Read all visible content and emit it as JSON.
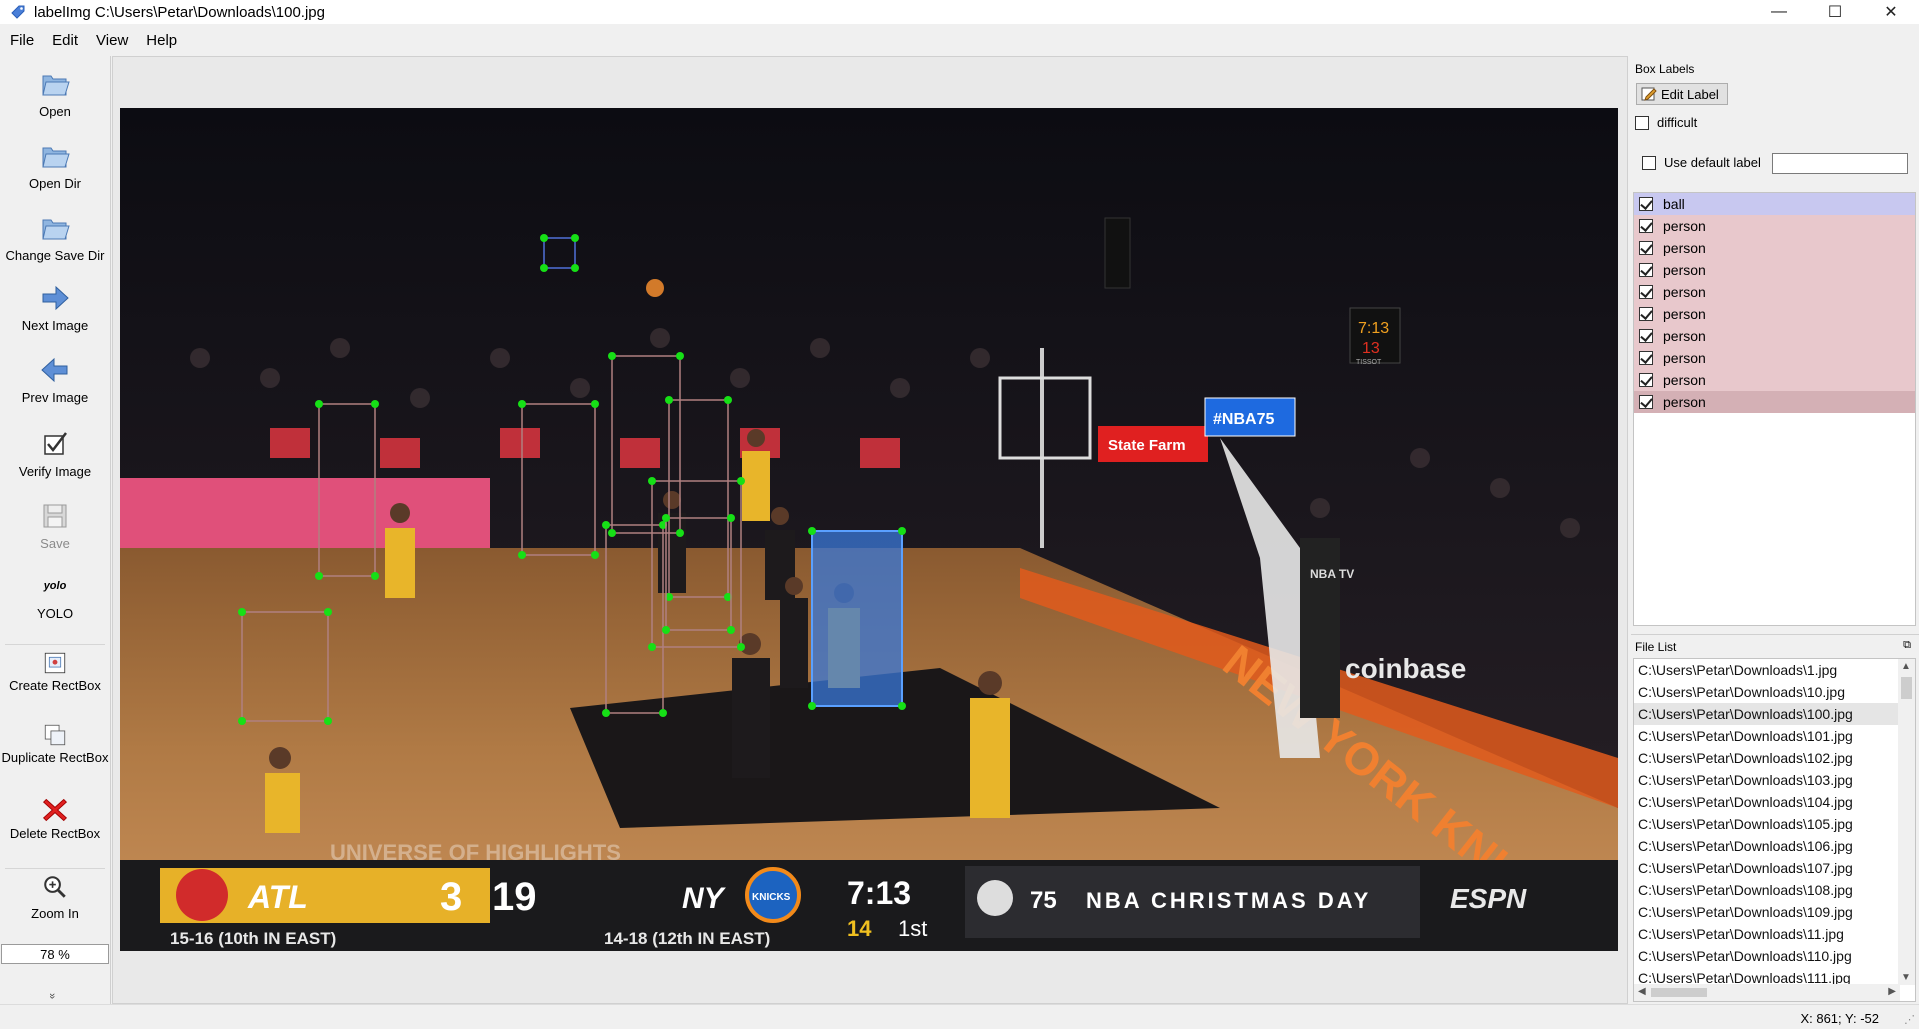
{
  "window": {
    "title": "labelImg C:\\Users\\Petar\\Downloads\\100.jpg",
    "minimize": "—",
    "maximize": "☐",
    "close": "✕"
  },
  "menu": [
    "File",
    "Edit",
    "View",
    "Help"
  ],
  "toolbar": {
    "open": "Open",
    "open_dir": "Open Dir",
    "change_save_dir": "Change Save Dir",
    "next_image": "Next Image",
    "prev_image": "Prev Image",
    "verify_image": "Verify Image",
    "save": "Save",
    "yolo_icon_text": "yolo",
    "yolo": "YOLO",
    "create_rectbox": "Create RectBox",
    "duplicate_rectbox": "Duplicate RectBox",
    "delete_rectbox": "Delete RectBox",
    "zoom_in": "Zoom In",
    "zoom_level": "78 %",
    "more": "»"
  },
  "box_labels": {
    "title": "Box Labels",
    "edit_label": "Edit Label",
    "difficult": "difficult",
    "use_default_label": "Use default label",
    "default_label_value": "",
    "items": [
      {
        "label": "ball",
        "checked": true,
        "color": "#c8c8f0"
      },
      {
        "label": "person",
        "checked": true,
        "color": "#e8c8cc"
      },
      {
        "label": "person",
        "checked": true,
        "color": "#e8c8cc"
      },
      {
        "label": "person",
        "checked": true,
        "color": "#e8c8cc"
      },
      {
        "label": "person",
        "checked": true,
        "color": "#e8c8cc"
      },
      {
        "label": "person",
        "checked": true,
        "color": "#e8c8cc"
      },
      {
        "label": "person",
        "checked": true,
        "color": "#e8c8cc"
      },
      {
        "label": "person",
        "checked": true,
        "color": "#e8c8cc"
      },
      {
        "label": "person",
        "checked": true,
        "color": "#e8c8cc"
      },
      {
        "label": "person",
        "checked": true,
        "color": "#d4b0b5"
      }
    ]
  },
  "file_list": {
    "title": "File List",
    "float_icon": "⧉",
    "selected": "C:\\Users\\Petar\\Downloads\\100.jpg",
    "items": [
      "C:\\Users\\Petar\\Downloads\\1.jpg",
      "C:\\Users\\Petar\\Downloads\\10.jpg",
      "C:\\Users\\Petar\\Downloads\\100.jpg",
      "C:\\Users\\Petar\\Downloads\\101.jpg",
      "C:\\Users\\Petar\\Downloads\\102.jpg",
      "C:\\Users\\Petar\\Downloads\\103.jpg",
      "C:\\Users\\Petar\\Downloads\\104.jpg",
      "C:\\Users\\Petar\\Downloads\\105.jpg",
      "C:\\Users\\Petar\\Downloads\\106.jpg",
      "C:\\Users\\Petar\\Downloads\\107.jpg",
      "C:\\Users\\Petar\\Downloads\\108.jpg",
      "C:\\Users\\Petar\\Downloads\\109.jpg",
      "C:\\Users\\Petar\\Downloads\\11.jpg",
      "C:\\Users\\Petar\\Downloads\\110.jpg",
      "C:\\Users\\Petar\\Downloads\\111.jpg"
    ]
  },
  "scoreboard": {
    "home_team": "ATL",
    "home_score": "3",
    "home_record": "15-16 (10th IN EAST)",
    "shot_clock": "19",
    "away_team": "NY",
    "away_record": "14-18 (12th IN EAST)",
    "game_clock": "7:13",
    "shot_clock_small": "14",
    "quarter": "1st",
    "event": "NBA CHRISTMAS DAY",
    "network": "ESPN",
    "anniversary": "75",
    "watermark": "UNIVERSE OF HIGHLIGHTS",
    "arena_sponsor": "coinbase",
    "sponsor_2": "State Farm",
    "nba75_sign": "#NBA75",
    "court_text": "NEW YORK KNICKS",
    "nbatv": "NBA TV",
    "shot_clock_display": "7:13",
    "shot_clock_display_2": "13",
    "tissot": "TISSOT",
    "knicks_logo": "KNICKS"
  },
  "annotation_colors": {
    "box_line": "#b08080",
    "vertex": "#16e016",
    "selected_fill": "#3a78d8",
    "selected_line": "#5aa0ff",
    "ball_line": "#5070d8"
  },
  "status": {
    "coords": "X: 861; Y: -52",
    "grip": "⋰"
  }
}
